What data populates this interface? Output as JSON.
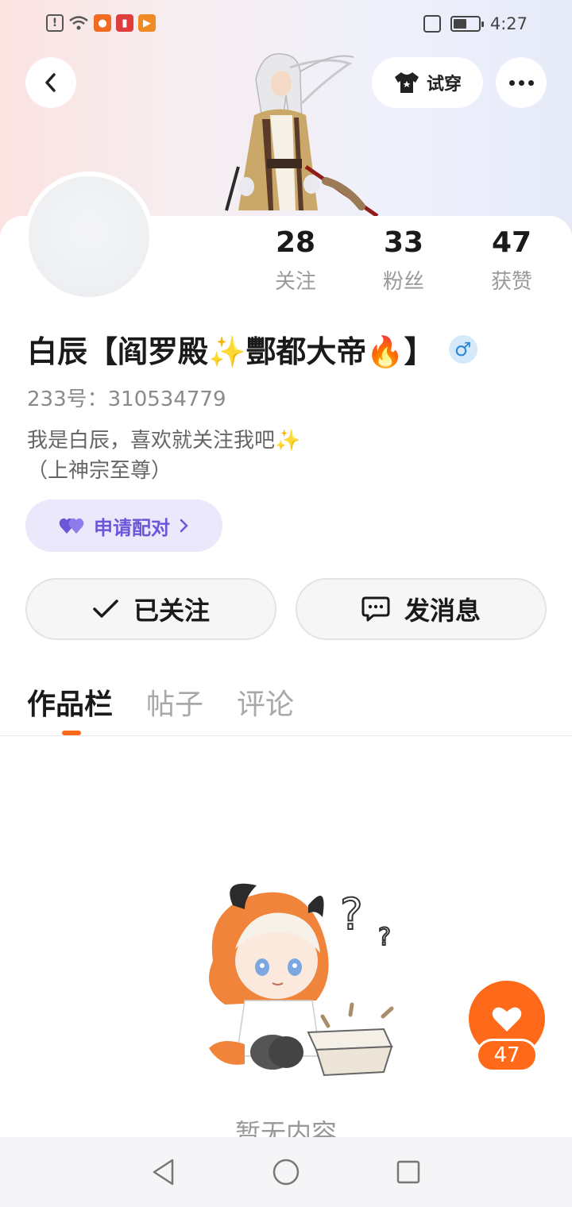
{
  "status_bar": {
    "time": "4:27",
    "icons": [
      "notification-icon",
      "wifi-icon",
      "app-icon-1",
      "app-icon-2",
      "app-icon-3"
    ]
  },
  "header": {
    "tryon_label": "试穿"
  },
  "profile": {
    "stats": [
      {
        "value": "28",
        "label": "关注"
      },
      {
        "value": "33",
        "label": "粉丝"
      },
      {
        "value": "47",
        "label": "获赞"
      }
    ],
    "name": "白辰【阎罗殿✨酆都大帝🔥】",
    "gender_symbol": "♂",
    "uid": "233号：310534779",
    "bio_line1": "我是白辰，喜欢就关注我吧✨",
    "bio_line2": "（上神宗至尊）"
  },
  "actions": {
    "pair_label": "申请配对",
    "follow_label": "已关注",
    "message_label": "发消息"
  },
  "tabs": [
    {
      "label": "作品栏",
      "active": true
    },
    {
      "label": "帖子",
      "active": false
    },
    {
      "label": "评论",
      "active": false
    }
  ],
  "empty_state": {
    "text": "暂无内容"
  },
  "like_fab": {
    "count": "47"
  },
  "colors": {
    "accent": "#ff6a1a",
    "pair_bg": "#ece8fb",
    "pair_text": "#6b56d9"
  }
}
